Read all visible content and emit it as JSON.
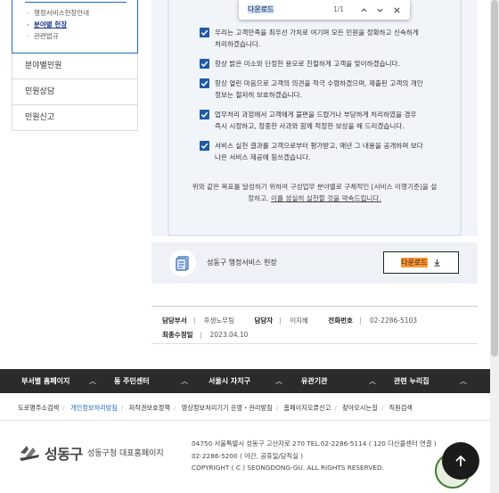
{
  "find_bar": {
    "query": "다운로드",
    "count": "1/1"
  },
  "sidebar": {
    "sub_items": [
      {
        "label": "행정서비스헌장안내",
        "active": false
      },
      {
        "label": "분야별 헌장",
        "active": true
      },
      {
        "label": "관련법규",
        "active": false
      }
    ],
    "menu": [
      {
        "label": "분야별민원"
      },
      {
        "label": "민원상담"
      },
      {
        "label": "민원신고"
      }
    ]
  },
  "pledges": [
    {
      "lines": [
        "우리는 고객만족을 최우선 가치로 여기며 모든 민원을 정확하고 신속하게",
        "처리하겠습니다."
      ]
    },
    {
      "lines": [
        "항상 밝은 미소와 단정한 용모로 친절하게 고객을 맞이하겠습니다."
      ]
    },
    {
      "lines": [
        "항상 열린 마음으로 고객의 의견을 적극 수렴하겠으며, 제출된 고객의 개인",
        "정보는 철저히 보호하겠습니다."
      ]
    },
    {
      "lines": [
        "업무처리 과정에서 고객에게 불편을 드렸거나 부당하게 처리하였을 경우",
        "즉시 시정하고, 정중한 사과와 함께 적정한 보상을 해 드리겠습니다."
      ]
    },
    {
      "lines": [
        "서비스 실천 결과를 고객으로부터 평가받고, 매년 그 내용을 공개하며 보다",
        "나은 서비스 제공에 힘쓰겠습니다."
      ]
    }
  ],
  "pledge_footer": {
    "line1": "위와 같은 목표를 달성하기 위하여 구성업무 분야별로 구체적인 [서비스 이행기준]을 설",
    "line2_prefix": "정하고, ",
    "line2_underlined": "이를 성실히 실천할 것을 약속드립니다."
  },
  "download": {
    "title": "성동구 행정서비스 헌장",
    "button_label": "다운로드"
  },
  "info": {
    "dept_label": "담당부서",
    "dept_value": "후생노무팀",
    "manager_label": "담당자",
    "manager_value": "이지혜",
    "phone_label": "전화번호",
    "phone_value": "02-2286-5103",
    "modified_label": "최종수정일",
    "modified_value": "2023.04.10"
  },
  "bottom_nav": [
    {
      "label": "부서별 홈페이지"
    },
    {
      "label": "동 주민센터"
    },
    {
      "label": "서울시 자치구"
    },
    {
      "label": "유관기관"
    },
    {
      "label": "관련 누리집"
    }
  ],
  "footer_links": [
    {
      "label": "도로명주소검색",
      "emphasis": false
    },
    {
      "label": "개인정보처리방침",
      "emphasis": true
    },
    {
      "label": "저작권보호정책",
      "emphasis": false
    },
    {
      "label": "영상정보처리기기 운영・관리방침",
      "emphasis": false
    },
    {
      "label": "홈페이지오류신고",
      "emphasis": false
    },
    {
      "label": "찾아오시는길",
      "emphasis": false
    },
    {
      "label": "직원검색",
      "emphasis": false
    }
  ],
  "footer": {
    "logo_name": "성동구",
    "site_name": "성동구청 대표홈페이지",
    "address": "04750 서울특별시 성동구 고산자로 270     TEL.02-2286-5114 ( 120 다산콜센터 연결 )",
    "hours": "02-2286-5200 ( 야간, 공휴일/당직실 )",
    "copyright": "COPYRIGHT ( C ) SEONGDONG-GU. ALL RIGHTS RESERVED."
  },
  "colors": {
    "accent": "#1e6bb8",
    "highlight": "#ff9632",
    "check": "#1e5aa8",
    "dark_bar": "#2b2b2b"
  },
  "icons": {
    "check": "checkbox-check-icon",
    "document": "document-icon",
    "download": "download-arrow-icon",
    "top": "arrow-up-icon"
  }
}
